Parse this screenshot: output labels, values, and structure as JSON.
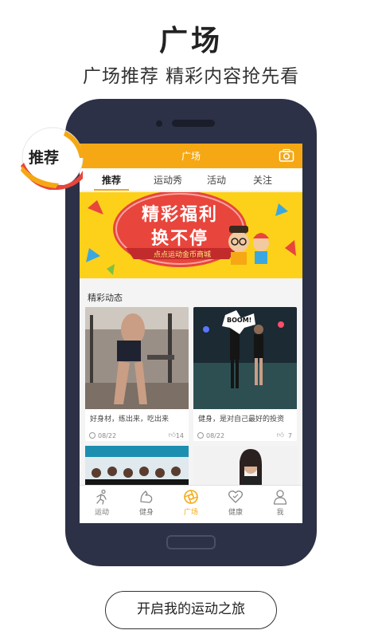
{
  "promo": {
    "title": "广场",
    "subtitle": "广场推荐 精彩内容抢先看",
    "badge": "推荐",
    "cta": "开启我的运动之旅"
  },
  "app": {
    "title": "广场",
    "accent": "#f5a814",
    "tabs": [
      {
        "label": "推荐",
        "active": true
      },
      {
        "label": "运动秀",
        "active": false
      },
      {
        "label": "活动",
        "active": false
      },
      {
        "label": "关注",
        "active": false
      }
    ],
    "banner": {
      "line1": "精彩福利",
      "line2": "换不停",
      "caption": "点点运动金币商城"
    },
    "section_title": "精彩动态",
    "cards": [
      {
        "text": "好身材，练出来，吃出来",
        "date": "08/22",
        "likes": "14",
        "image": "gym-photo"
      },
      {
        "text": "健身，是对自己最好的投资",
        "date": "08/22",
        "likes": "7",
        "image": "dance-photo",
        "sticker": "BOOM!"
      }
    ],
    "nav": [
      {
        "label": "运动",
        "icon": "run-icon",
        "active": false
      },
      {
        "label": "健身",
        "icon": "muscle-icon",
        "active": false
      },
      {
        "label": "广场",
        "icon": "aperture-icon",
        "active": true
      },
      {
        "label": "健康",
        "icon": "heart-icon",
        "active": false
      },
      {
        "label": "我",
        "icon": "user-icon",
        "active": false
      }
    ]
  }
}
